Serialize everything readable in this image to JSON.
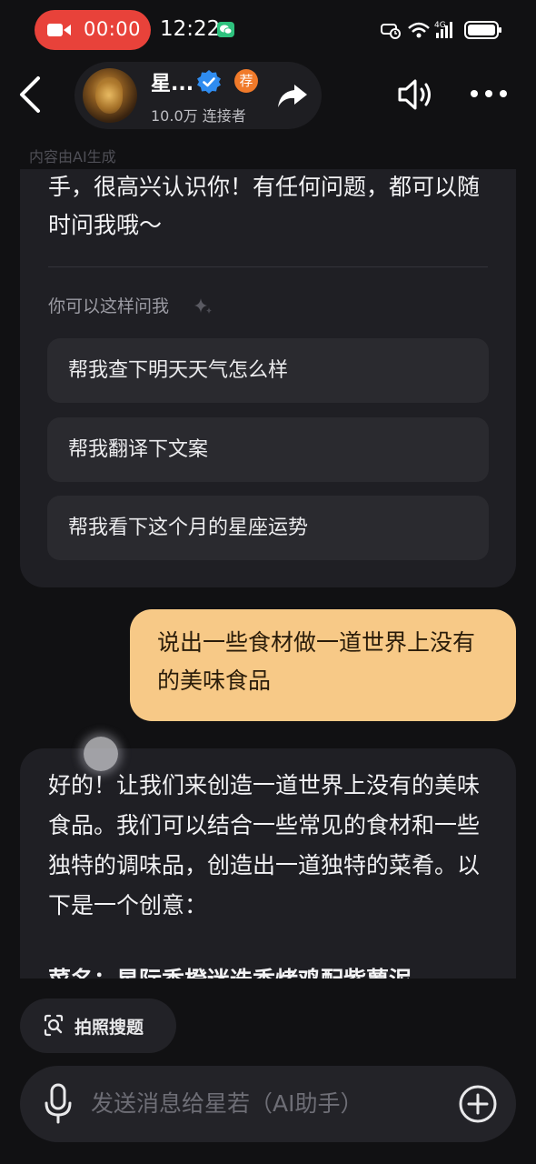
{
  "status_bar": {
    "recording_time": "00:00",
    "clock": "12:22",
    "network": "4G"
  },
  "header": {
    "name": "星...",
    "badge": "荐",
    "connect_count": "10.0万 连接者"
  },
  "ai_note": "内容由AI生成",
  "chat": {
    "intro_text": "手，很高兴认识你！有任何问题，都可以随时问我哦～",
    "suggest_title": "你可以这样问我",
    "suggestions": [
      "帮我查下明天天气怎么样",
      "帮我翻译下文案",
      "帮我看下这个月的星座运势"
    ],
    "user_message": "说出一些食材做一道世界上没有的美味食品",
    "bot_reply": "好的！让我们来创造一道世界上没有的美味食品。我们可以结合一些常见的食材和一些独特的调味品，创造出一道独特的菜肴。以下是一个创意：",
    "bot_reply_dish": "菜名：星际香橙迷迭香烤鸡配紫薯泥"
  },
  "bottom": {
    "photo_search_label": "拍照搜题",
    "input_placeholder": "发送消息给星若（AI助手）"
  },
  "colors": {
    "background": "#111113",
    "bubble_bot": "#1f1f24",
    "bubble_user": "#f7c987",
    "recording": "#e8423a",
    "verified": "#2f8cf0",
    "badge": "#f07a2a"
  }
}
